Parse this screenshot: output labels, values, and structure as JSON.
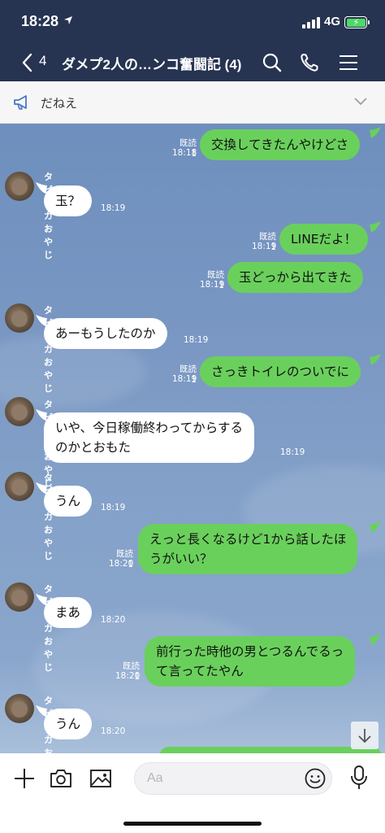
{
  "status_bar": {
    "time": "18:28",
    "network": "4G"
  },
  "header": {
    "back_count": "4",
    "title": "ダメプ2人の…ンコ奮闘記 (4)"
  },
  "announcement": {
    "text": "だねえ"
  },
  "messages": [
    {
      "side": "me",
      "text": "交換してきたんやけどさ",
      "read": "既読 1",
      "time": "18:18"
    },
    {
      "side": "them",
      "sender": "タピオカおやじ",
      "text": "玉？",
      "time": "18:19"
    },
    {
      "side": "me",
      "text": "LINEだよ！",
      "read": "既読 1",
      "time": "18:19"
    },
    {
      "side": "me",
      "text": "玉どっから出てきた",
      "read": "既読 1",
      "time": "18:19"
    },
    {
      "side": "them",
      "sender": "タピオカおやじ",
      "text": "あーもうしたのか",
      "time": "18:19"
    },
    {
      "side": "me",
      "text": "さっきトイレのついでに",
      "read": "既読 1",
      "time": "18:19"
    },
    {
      "side": "them",
      "sender": "タピオカおやじ",
      "lines": [
        "いや、今日稼働終わってからする",
        "のかとおもた"
      ],
      "time": "18:19"
    },
    {
      "side": "them",
      "sender": "タピオカおやじ",
      "text": "うん",
      "time": "18:19"
    },
    {
      "side": "me",
      "lines": [
        "えっと長くなるけど1から話したほ",
        "うがいい？"
      ],
      "read": "既読 1",
      "time": "18:20"
    },
    {
      "side": "them",
      "sender": "タピオカおやじ",
      "text": "まあ",
      "time": "18:20"
    },
    {
      "side": "me",
      "lines": [
        "前行った時他の男とつるんでるっ",
        "て言ってたやん"
      ],
      "read": "既読 1",
      "time": "18:20"
    },
    {
      "side": "them",
      "sender": "タピオカおやじ",
      "text": "うん",
      "time": "18:20"
    }
  ],
  "input": {
    "placeholder": "Aa"
  },
  "icons": {
    "back": "chevron-left-icon",
    "search": "search-icon",
    "call": "phone-icon",
    "menu": "menu-icon",
    "announcement": "megaphone-icon",
    "expand": "chevron-down-icon",
    "scroll": "arrow-down-icon",
    "add": "plus-icon",
    "camera": "camera-icon",
    "gallery": "image-icon",
    "emoji": "smiley-icon",
    "mic": "microphone-icon"
  },
  "colors": {
    "header": "#263351",
    "my_bubble": "#6ad05c",
    "their_bubble": "#ffffff",
    "battery": "#4cd964"
  }
}
